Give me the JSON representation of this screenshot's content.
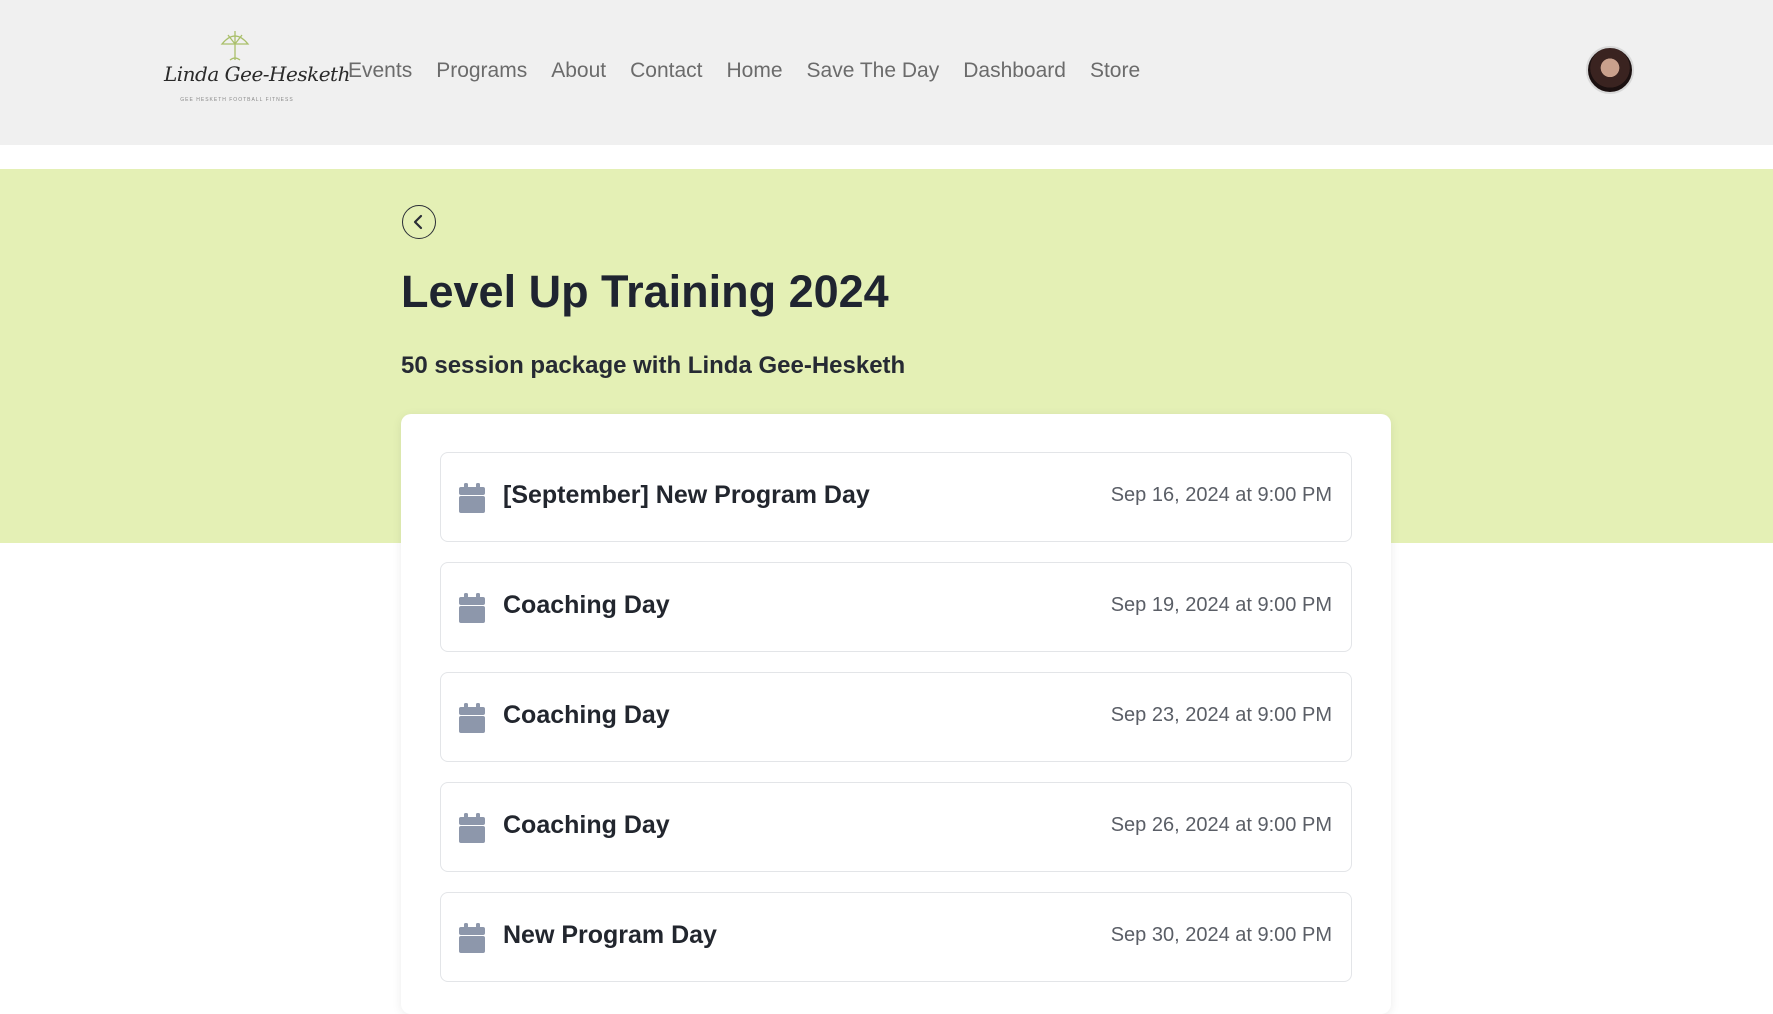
{
  "header": {
    "logo": {
      "script_text": "Linda Gee-Hesketh",
      "tagline": "GEE HESKETH FOOTBALL FITNESS"
    },
    "nav": [
      {
        "label": "Events"
      },
      {
        "label": "Programs"
      },
      {
        "label": "About"
      },
      {
        "label": "Contact"
      },
      {
        "label": "Home"
      },
      {
        "label": "Save The Day"
      },
      {
        "label": "Dashboard"
      },
      {
        "label": "Store"
      }
    ]
  },
  "hero": {
    "title": "Level Up Training 2024",
    "subtitle": "50 session package with Linda Gee-Hesketh"
  },
  "sessions": [
    {
      "name": "[September] New Program Day",
      "date": "Sep 16, 2024 at 9:00 PM",
      "icon": "calendar-icon"
    },
    {
      "name": "Coaching Day",
      "date": "Sep 19, 2024 at 9:00 PM",
      "icon": "calendar-icon"
    },
    {
      "name": "Coaching Day",
      "date": "Sep 23, 2024 at 9:00 PM",
      "icon": "calendar-icon"
    },
    {
      "name": "Coaching Day",
      "date": "Sep 26, 2024 at 9:00 PM",
      "icon": "calendar-icon"
    },
    {
      "name": "New Program Day",
      "date": "Sep 30, 2024 at 9:00 PM",
      "icon": "calendar-icon"
    }
  ],
  "colors": {
    "header_bg": "#f0f0f0",
    "hero_bg": "#e4f0b5",
    "calendar_icon": "#8d97ab",
    "title_text": "#1f2430"
  }
}
